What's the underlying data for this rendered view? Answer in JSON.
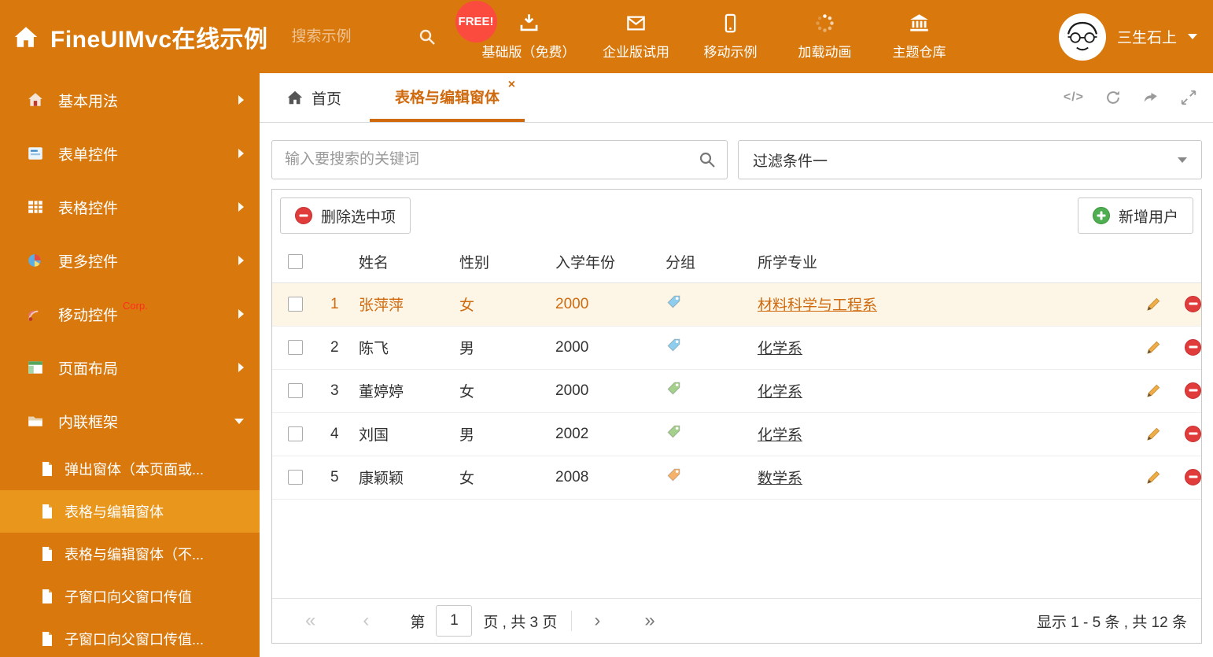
{
  "colors": {
    "header_bg": "#d9790d",
    "sidebar_active_bg": "#e9961c",
    "active_tab": "#cf6a0e",
    "selected_row_bg": "#fdf6e7",
    "free_badge_bg": "#fb4a3e",
    "delete_red": "#e03c3c",
    "add_green": "#4fae50",
    "tag_blue": "#8ecdee",
    "tag_green": "#a5cf8d",
    "tag_orange": "#f6b26b"
  },
  "header": {
    "title": "FineUIMvc在线示例",
    "search_placeholder": "搜索示例",
    "free_badge": "FREE!",
    "nav": [
      {
        "label": "基础版（免费）",
        "icon": "download-icon"
      },
      {
        "label": "企业版试用",
        "icon": "envelope-icon"
      },
      {
        "label": "移动示例",
        "icon": "mobile-icon"
      },
      {
        "label": "加载动画",
        "icon": "spinner-icon"
      },
      {
        "label": "主题仓库",
        "icon": "bank-icon"
      }
    ],
    "user_name": "三生石上"
  },
  "sidebar": {
    "items": [
      {
        "label": "基本用法"
      },
      {
        "label": "表单控件"
      },
      {
        "label": "表格控件"
      },
      {
        "label": "更多控件"
      },
      {
        "label": "移动控件",
        "badge": "Corp."
      },
      {
        "label": "页面布局"
      },
      {
        "label": "内联框架"
      }
    ],
    "subitems": [
      {
        "label": "弹出窗体（本页面或..."
      },
      {
        "label": "表格与编辑窗体"
      },
      {
        "label": "表格与编辑窗体（不..."
      },
      {
        "label": "子窗口向父窗口传值"
      },
      {
        "label": "子窗口向父窗口传值..."
      }
    ]
  },
  "tabs": {
    "home": "首页",
    "active": "表格与编辑窗体",
    "close": "×",
    "code_icon": "</>"
  },
  "filters": {
    "search_placeholder": "输入要搜索的关键词",
    "filter_value": "过滤条件一"
  },
  "toolbar": {
    "delete_label": "删除选中项",
    "add_label": "新增用户"
  },
  "table": {
    "headers": [
      "姓名",
      "性别",
      "入学年份",
      "分组",
      "所学专业"
    ],
    "rows": [
      {
        "num": "1",
        "name": "张萍萍",
        "gender": "女",
        "year": "2000",
        "major": "材料科学与工程系",
        "tag_class": "tag tag-blue",
        "row_class": "selected"
      },
      {
        "num": "2",
        "name": "陈飞",
        "gender": "男",
        "year": "2000",
        "major": "化学系",
        "tag_class": "tag tag-blue",
        "row_class": ""
      },
      {
        "num": "3",
        "name": "董婷婷",
        "gender": "女",
        "year": "2000",
        "major": "化学系",
        "tag_class": "tag tag-green",
        "row_class": ""
      },
      {
        "num": "4",
        "name": "刘国",
        "gender": "男",
        "year": "2002",
        "major": "化学系",
        "tag_class": "tag tag-green",
        "row_class": ""
      },
      {
        "num": "5",
        "name": "康颖颖",
        "gender": "女",
        "year": "2008",
        "major": "数学系",
        "tag_class": "tag tag-orange",
        "row_class": ""
      }
    ]
  },
  "pagination": {
    "first": "«",
    "prev": "‹",
    "page_prefix": "第",
    "current_page": "1",
    "page_suffix": "页 , 共 3 页",
    "next": "›",
    "last": "»",
    "summary": "显示 1 - 5 条 , 共 12 条"
  }
}
